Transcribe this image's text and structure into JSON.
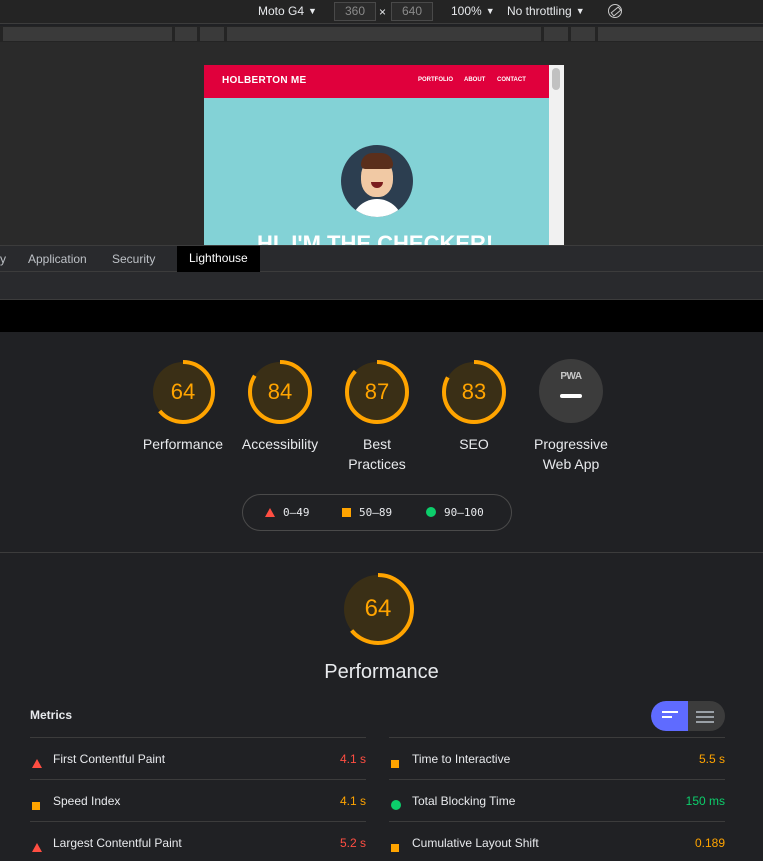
{
  "device_toolbar": {
    "device": "Moto G4",
    "width": "360",
    "times": "×",
    "height": "640",
    "zoom": "100%",
    "throttling": "No throttling"
  },
  "mock_page": {
    "brand": "HOLBERTON ME",
    "nav": [
      "PORTFOLIO",
      "ABOUT",
      "CONTACT"
    ],
    "hero": "HI, I'M THE CHECKER!"
  },
  "devtools_tabs": {
    "partial": "y",
    "items": [
      "Application",
      "Security",
      "Lighthouse"
    ],
    "active": "Lighthouse"
  },
  "scores": [
    {
      "label": "Performance",
      "value": 64,
      "display": "64"
    },
    {
      "label": "Accessibility",
      "value": 84,
      "display": "84"
    },
    {
      "label_line1": "Best",
      "label_line2": "Practices",
      "value": 87,
      "display": "87"
    },
    {
      "label": "SEO",
      "value": 83,
      "display": "83"
    },
    {
      "label_line1": "Progressive",
      "label_line2": "Web App",
      "badge": "PWA"
    }
  ],
  "legend": {
    "fail": "0–49",
    "average": "50–89",
    "pass": "90–100"
  },
  "performance": {
    "score": 64,
    "score_text": "64",
    "title": "Performance"
  },
  "metrics": {
    "title": "Metrics",
    "left": [
      {
        "name": "First Contentful Paint",
        "value": "4.1 s",
        "status": "fail"
      },
      {
        "name": "Speed Index",
        "value": "4.1 s",
        "status": "average"
      },
      {
        "name": "Largest Contentful Paint",
        "value": "5.2 s",
        "status": "fail"
      }
    ],
    "right": [
      {
        "name": "Time to Interactive",
        "value": "5.5 s",
        "status": "average"
      },
      {
        "name": "Total Blocking Time",
        "value": "150 ms",
        "status": "pass"
      },
      {
        "name": "Cumulative Layout Shift",
        "value": "0.189",
        "status": "average"
      }
    ]
  },
  "colors": {
    "fail": "#ff4e42",
    "average": "#ffa400",
    "pass": "#0cce6b",
    "toggle_accent": "#5f6bff",
    "mock_header": "#e0003c",
    "mock_bg": "#83d2d6"
  }
}
